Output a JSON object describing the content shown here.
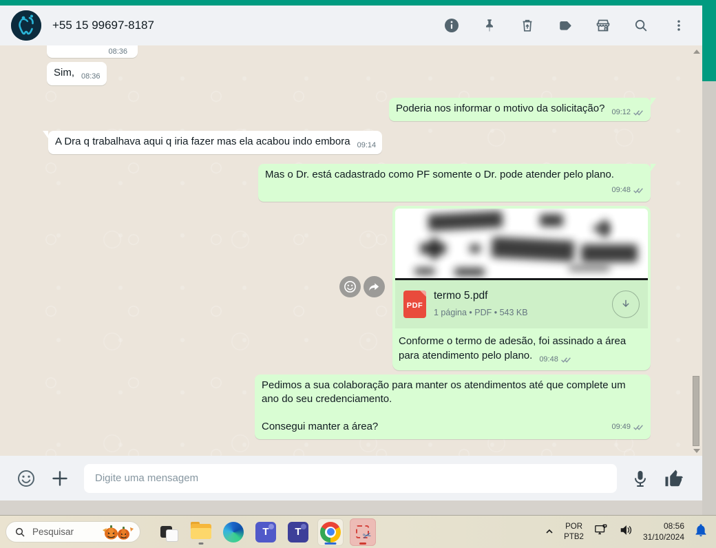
{
  "header": {
    "phone": "+55 15 99697-8187",
    "icon_names": [
      "info-icon",
      "pin-icon",
      "clear-chat-icon",
      "label-icon",
      "storefront-icon",
      "search-icon",
      "menu-icon"
    ]
  },
  "chat": {
    "messages": [
      {
        "direction": "in",
        "time": "08:36"
      },
      {
        "direction": "in",
        "text": "Sim,",
        "time": "08:36"
      },
      {
        "direction": "out",
        "text": "Poderia nos informar o motivo da solicitação?",
        "time": "09:12",
        "status": "delivered"
      },
      {
        "direction": "in",
        "text": "A Dra q trabalhava aqui q iria fazer mas ela acabou indo embora",
        "time": "09:14"
      },
      {
        "direction": "out",
        "text": "Mas o Dr. está cadastrado como PF somente o Dr. pode atender pelo plano.",
        "time": "09:48",
        "status": "delivered"
      },
      {
        "direction": "out",
        "type": "document",
        "file": {
          "badge": "PDF",
          "name": "termo 5.pdf",
          "meta": "1 página • PDF • 543 KB"
        },
        "caption": "Conforme o termo de adesão, foi assinado a área para atendimento pelo plano.",
        "time": "09:48",
        "status": "delivered"
      },
      {
        "direction": "out",
        "text1": "Pedimos a sua colaboração para manter os atendimentos até que complete um ano do seu credenciamento.",
        "text2": "Consegui manter a área?",
        "time": "09:49",
        "status": "delivered"
      }
    ]
  },
  "composer": {
    "placeholder": "Digite uma mensagem"
  },
  "taskbar": {
    "search_placeholder": "Pesquisar",
    "apps": [
      "task-view",
      "file-explorer",
      "edge",
      "teams-classic",
      "teams-new",
      "chrome",
      "snipping-tool"
    ],
    "tray": {
      "lang_top": "POR",
      "lang_bottom": "PTB2",
      "time": "08:56",
      "date": "31/10/2024"
    }
  },
  "colors": {
    "accent_green": "#009b80",
    "bubble_out": "#d9fdd3",
    "bubble_in": "#ffffff",
    "pdf_red": "#e94b3c",
    "bell_blue": "#0a58ca"
  }
}
